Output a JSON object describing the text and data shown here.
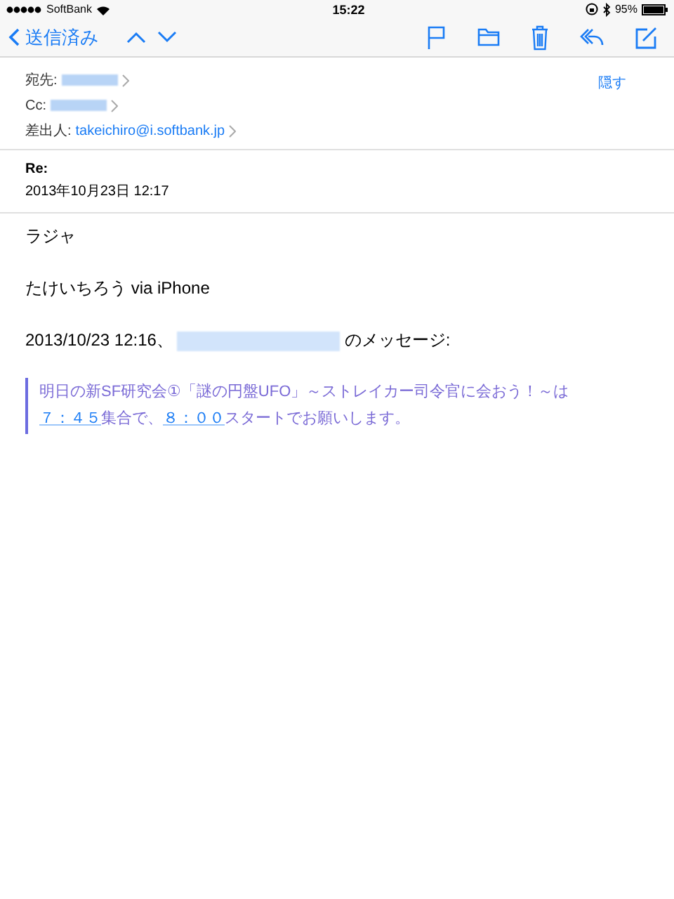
{
  "status_bar": {
    "carrier": "SoftBank",
    "time": "15:22",
    "battery": "95%"
  },
  "nav_bar": {
    "back": "送信済み"
  },
  "header": {
    "hide": "隠す",
    "fields": [
      {
        "label": "宛先:",
        "kind": "redacted"
      },
      {
        "label": "Cc:",
        "kind": "redacted"
      },
      {
        "label": "差出人:",
        "kind": "address",
        "value": "takeichiro@i.softbank.jp"
      }
    ]
  },
  "subject": "Re:",
  "date": "2013年10月23日 12:17",
  "body": [
    {
      "kind": "text",
      "text": "ラジャ"
    },
    {
      "kind": "text",
      "text": "たけいちろう via iPhone"
    },
    {
      "kind": "attribution",
      "before": "2013/10/23 12:16、",
      "after": "のメッセージ:"
    }
  ],
  "quote": [
    {
      "kind": "text",
      "text": "明日の新SF研究会①「謎の円盤UFO」～ストレイカー司令官に会おう！～は"
    },
    {
      "kind": "link",
      "text": "７：４５"
    },
    {
      "kind": "text",
      "text": "集合で、"
    },
    {
      "kind": "link",
      "text": "８：００"
    },
    {
      "kind": "text",
      "text": "スタートでお願いします。"
    }
  ]
}
